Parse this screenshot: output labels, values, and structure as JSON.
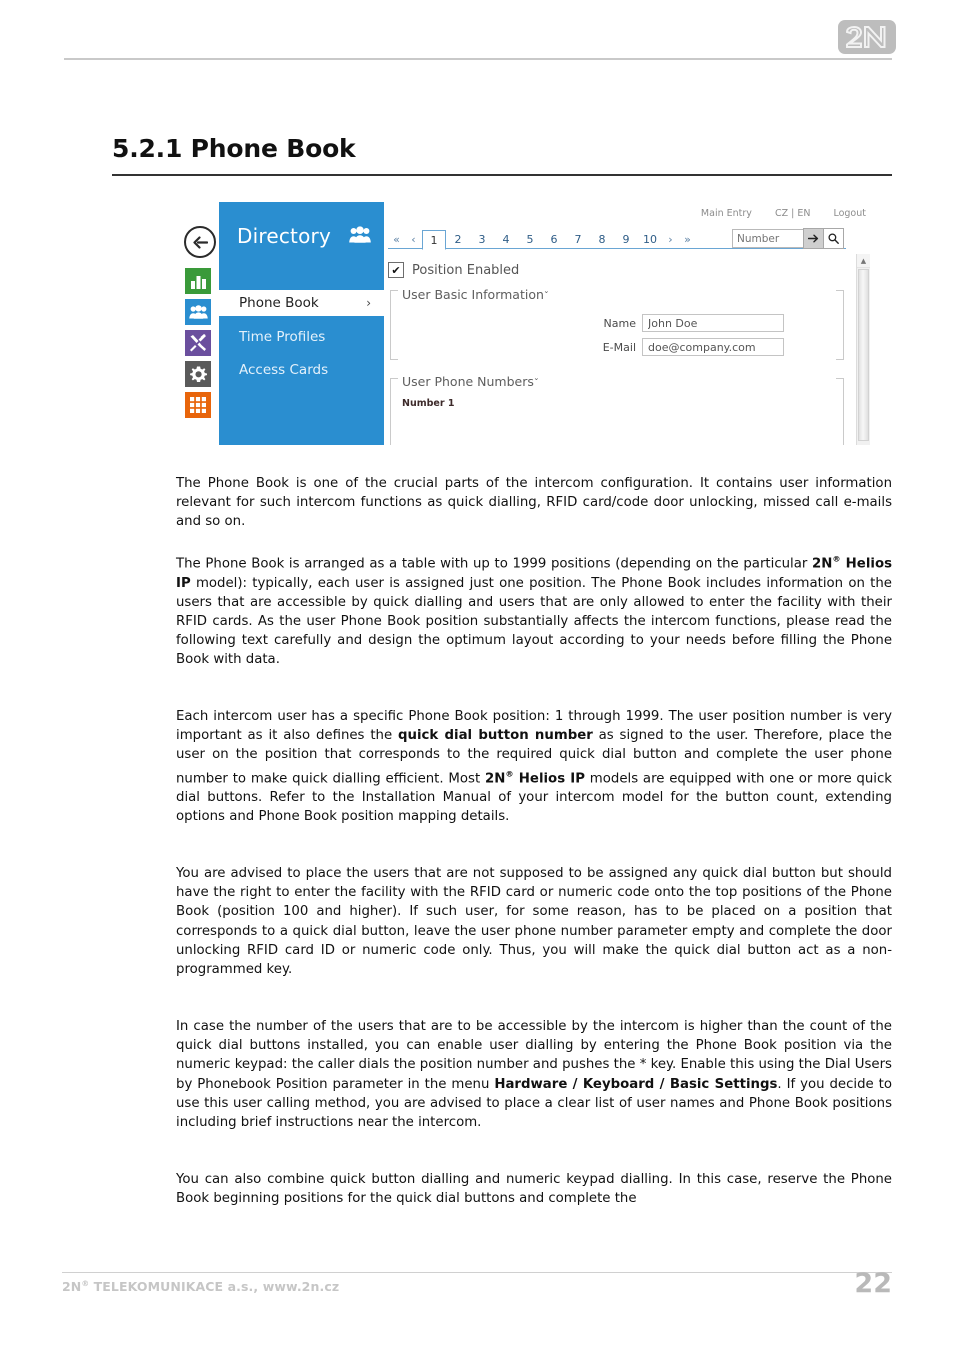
{
  "page": {
    "logo_alt": "2N",
    "heading": "5.2.1 Phone Book",
    "page_number": "22",
    "footer_brand": "2N",
    "footer_reg": "®",
    "footer_text": " TELEKOMUNIKACE a.s., www.2n.cz"
  },
  "ui": {
    "back_icon": "back-arrow-icon",
    "rail_icons": [
      {
        "name": "status-bar-chart-icon",
        "color": "#3a9a3a"
      },
      {
        "name": "directory-people-icon",
        "color": "#2a8ed0"
      },
      {
        "name": "hardware-tools-icon",
        "color": "#6b4f9e"
      },
      {
        "name": "services-gear-icon",
        "color": "#5a5a5a"
      },
      {
        "name": "system-grid-icon",
        "color": "#e8650b"
      }
    ],
    "panel": {
      "title": "Directory",
      "title_icon": "people-icon",
      "menu": [
        {
          "label": "Phone Book",
          "active": true,
          "chevron": "›"
        },
        {
          "label": "Time Profiles",
          "active": false
        },
        {
          "label": "Access Cards",
          "active": false
        }
      ]
    },
    "topbar": {
      "main_entry": "Main Entry",
      "language": "CZ | EN",
      "logout": "Logout"
    },
    "pager": {
      "first": "«",
      "prev": "‹",
      "pages": [
        "1",
        "2",
        "3",
        "4",
        "5",
        "6",
        "7",
        "8",
        "9",
        "10"
      ],
      "current": "1",
      "next": "›",
      "last": "»"
    },
    "search": {
      "placeholder": "Number",
      "value": "",
      "go_icon": "arrow-right-icon",
      "search_icon": "magnifier-icon"
    },
    "position_enabled": {
      "label": "Position Enabled",
      "checked": true,
      "check_glyph": "✔"
    },
    "groups": [
      {
        "title": "User Basic Information",
        "caret": "ˇ",
        "fields": [
          {
            "label": "Name",
            "value": "John Doe"
          },
          {
            "label": "E-Mail",
            "value": "doe@company.com"
          }
        ]
      },
      {
        "title": "User Phone Numbers",
        "caret": "ˇ",
        "sub_label": "Number 1"
      }
    ],
    "scrollbar": {
      "up_glyph": "▲"
    }
  },
  "content": {
    "paragraphs": [
      {
        "id": "p1",
        "runs": [
          {
            "t": "The Phone Book is one of the crucial parts of the intercom configuration. It contains user information relevant for such intercom functions as quick dialling, RFID card/code door unlocking, missed call e-mails and so on."
          }
        ]
      },
      {
        "id": "p2",
        "runs": [
          {
            "t": "The Phone Book is arranged as a table with up to 1999 positions (depending on the particular "
          },
          {
            "t": "2N",
            "b": true
          },
          {
            "t": "®",
            "b": true,
            "sup": true
          },
          {
            "t": " Helios IP",
            "b": true
          },
          {
            "t": " model): typically, each user is assigned just one position. The Phone Book includes information on the users that are accessible by quick dialling and users that are only allowed to enter the facility with their RFID cards. As the user Phone Book position substantially affects the intercom functions, please read the following text carefully and design the optimum layout according to your needs before filling the Phone Book with data."
          }
        ]
      },
      {
        "id": "p3",
        "runs": [
          {
            "t": "Each intercom user has a specific Phone Book position: 1 through 1999. The user position number is very important as it also defines the "
          },
          {
            "t": "quick dial button number",
            "b": true
          },
          {
            "t": " as signed to the user. Therefore, place the user on the position that corresponds to the required quick dial button and complete the user phone number to make quick dialling efficient. Most "
          },
          {
            "t": "2N",
            "b": true
          },
          {
            "t": "®",
            "b": true,
            "sup": true
          },
          {
            "t": " Helios IP",
            "b": true
          },
          {
            "t": " models are equipped with one or more quick dial buttons. Refer to the Installation Manual of your intercom model for the button count, extending options and Phone Book position mapping details."
          }
        ]
      },
      {
        "id": "p4",
        "runs": [
          {
            "t": "You are advised to place the users that are not supposed to be assigned any quick dial button but should have the right to enter the facility with the RFID card or numeric code onto the top positions of the Phone Book (position 100 and higher). If such user, for some reason, has to be placed on a position that corresponds to a quick dial button, leave the user phone number parameter empty and complete the door unlocking RFID card ID or numeric code only. Thus, you will make the quick dial button act as a non-programmed key."
          }
        ]
      },
      {
        "id": "p5",
        "runs": [
          {
            "t": "In case the number of the users that are to be accessible by the intercom is higher than the count of the quick dial buttons installed, you can enable user dialling by entering the Phone Book position via the numeric keypad: the caller dials the position number and pushes the * key. Enable this using the Dial Users by Phonebook Position parameter in the menu "
          },
          {
            "t": "Hardware / Keyboard / Basic Settings",
            "b": true
          },
          {
            "t": ". If you decide to use this user calling method, you are advised to place a clear list of user names and Phone Book positions including brief instructions near the intercom."
          }
        ]
      },
      {
        "id": "p6",
        "runs": [
          {
            "t": "You can also combine quick button dialling and numeric keypad dialling. In this case, reserve the Phone Book beginning positions for the quick dial buttons and complete the"
          }
        ]
      }
    ]
  }
}
